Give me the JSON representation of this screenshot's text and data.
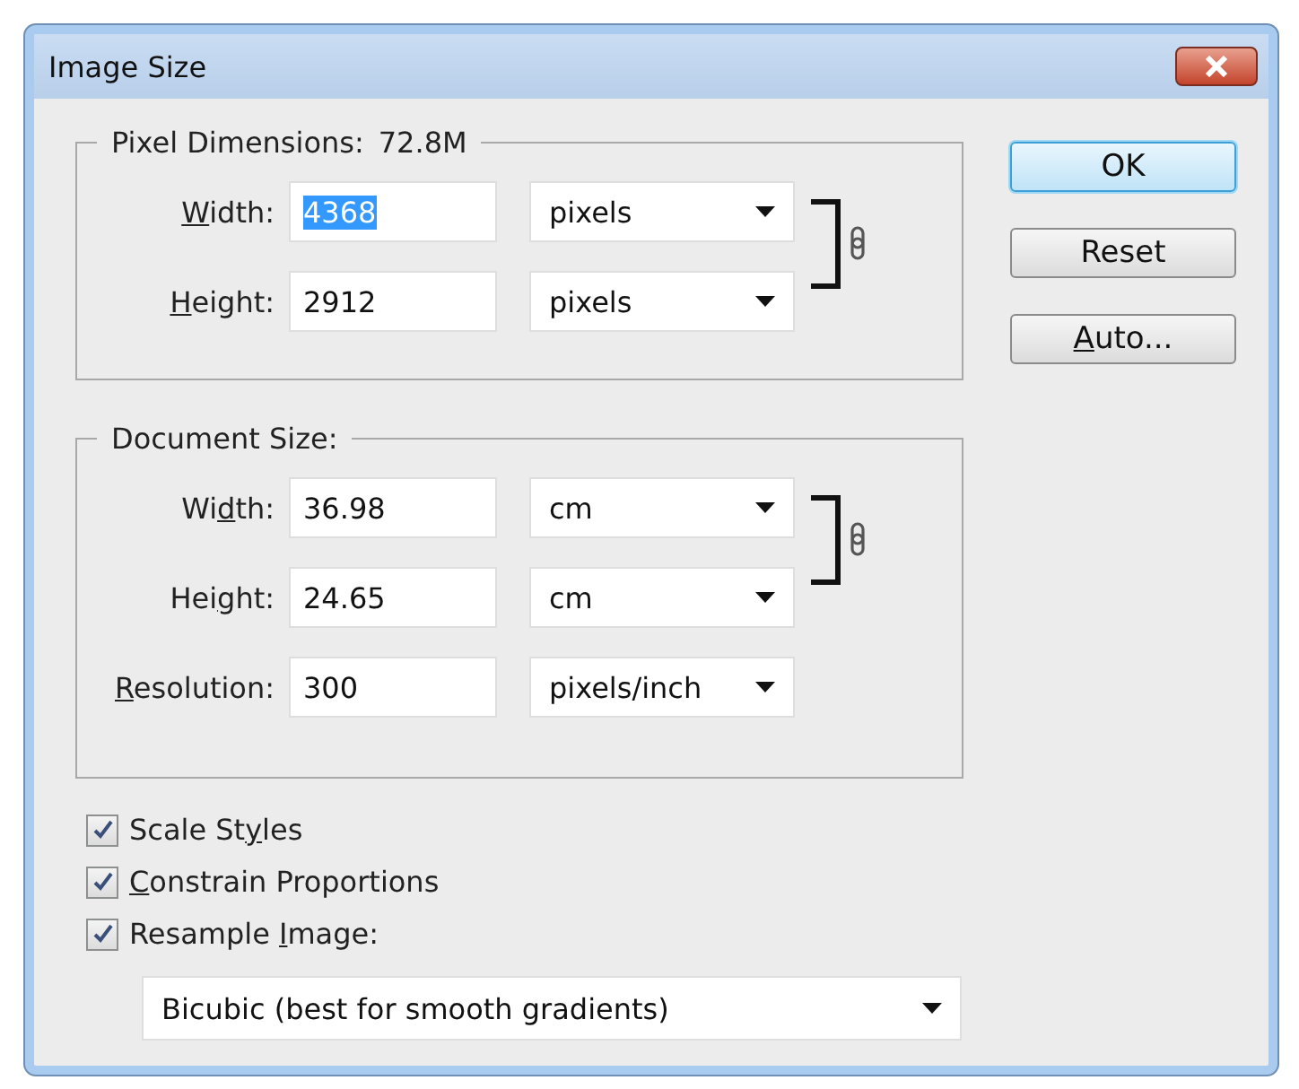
{
  "window": {
    "title": "Image Size"
  },
  "pixel_dimensions": {
    "title": "Pixel Dimensions:",
    "value": "72.8M",
    "constrained": true,
    "rows": [
      {
        "label": {
          "key": "W",
          "post": "idth:"
        },
        "value": "4368",
        "value_selected": true,
        "unit": "pixels"
      },
      {
        "label": {
          "key": "H",
          "post": "eight:"
        },
        "value": "2912",
        "value_selected": false,
        "unit": "pixels"
      }
    ]
  },
  "document_size": {
    "title": "Document Size:",
    "constrained": true,
    "rows": [
      {
        "label": {
          "pre": "Wi",
          "key": "d",
          "post": "th:"
        },
        "value": "36.98",
        "value_selected": false,
        "unit": "cm"
      },
      {
        "label": {
          "pre": "Hei",
          "key": "g",
          "post": "ht:"
        },
        "value": "24.65",
        "value_selected": false,
        "unit": "cm"
      },
      {
        "label": {
          "key": "R",
          "post": "esolution:"
        },
        "value": "300",
        "value_selected": false,
        "unit": "pixels/inch"
      }
    ]
  },
  "buttons": [
    {
      "label": {
        "post": "OK"
      },
      "default": true
    },
    {
      "label": {
        "post": "Reset"
      },
      "default": false
    },
    {
      "label": {
        "key": "A",
        "post": "uto..."
      },
      "default": false
    }
  ],
  "options": [
    {
      "label": {
        "pre": "Scale St",
        "key": "y",
        "post": "les"
      },
      "checked": true
    },
    {
      "label": {
        "key": "C",
        "post": "onstrain Proportions"
      },
      "checked": true
    },
    {
      "label": {
        "pre": "Resample ",
        "key": "I",
        "post": "mage:"
      },
      "checked": true
    }
  ],
  "resample_method": "Bicubic (best for smooth gradients)"
}
